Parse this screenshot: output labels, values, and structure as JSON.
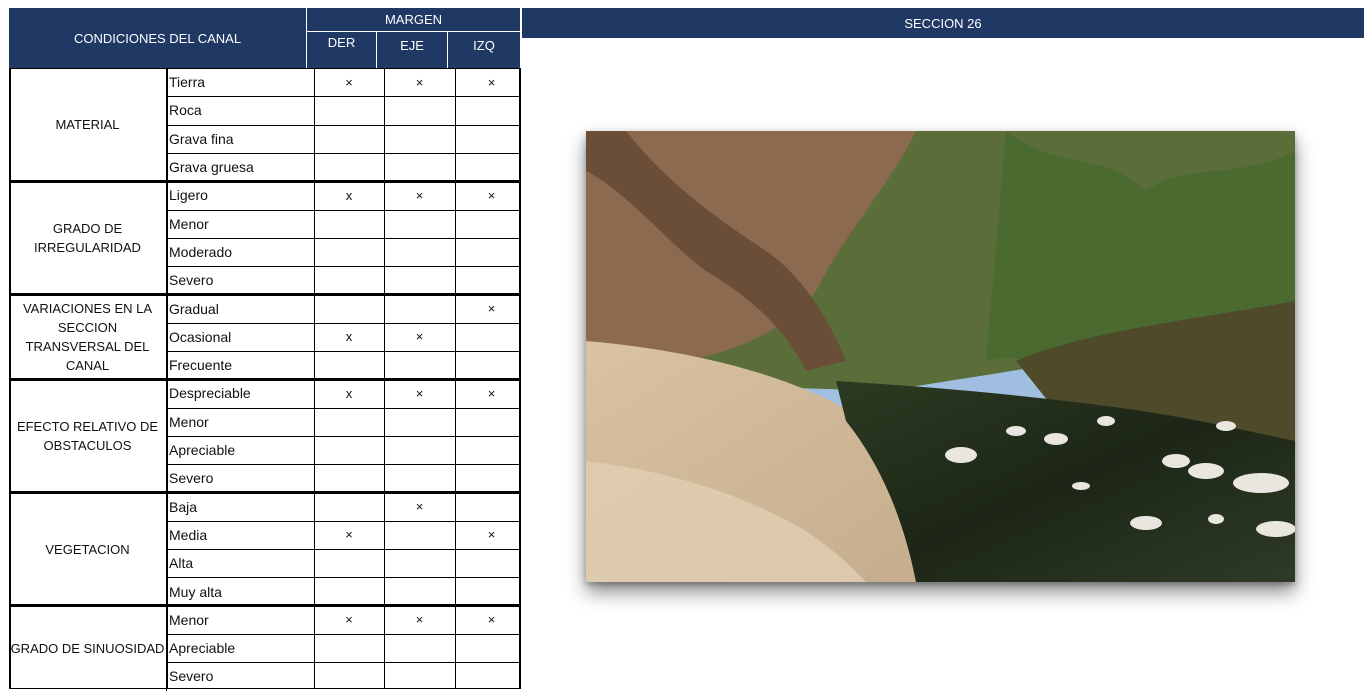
{
  "header": {
    "conditions_title": "CONDICIONES DEL CANAL",
    "margin_title": "MARGEN",
    "section_title": "SECCION 26",
    "columns": [
      "DER",
      "EJE",
      "IZQ"
    ]
  },
  "categories": [
    {
      "name": "MATERIAL",
      "rows": [
        {
          "option": "Tierra",
          "der": "×",
          "eje": "×",
          "izq": "×"
        },
        {
          "option": "Roca",
          "der": "",
          "eje": "",
          "izq": ""
        },
        {
          "option": "Grava fina",
          "der": "",
          "eje": "",
          "izq": ""
        },
        {
          "option": "Grava gruesa",
          "der": "",
          "eje": "",
          "izq": ""
        }
      ]
    },
    {
      "name": "GRADO DE IRREGULARIDAD",
      "rows": [
        {
          "option": "Ligero",
          "der": "x",
          "eje": "×",
          "izq": "×"
        },
        {
          "option": "Menor",
          "der": "",
          "eje": "",
          "izq": ""
        },
        {
          "option": "Moderado",
          "der": "",
          "eje": "",
          "izq": ""
        },
        {
          "option": "Severo",
          "der": "",
          "eje": "",
          "izq": ""
        }
      ]
    },
    {
      "name": "VARIACIONES EN LA SECCION TRANSVERSAL DEL CANAL",
      "rows": [
        {
          "option": "Gradual",
          "der": "",
          "eje": "",
          "izq": "×"
        },
        {
          "option": "Ocasional",
          "der": "x",
          "eje": "×",
          "izq": ""
        },
        {
          "option": "Frecuente",
          "der": "",
          "eje": "",
          "izq": ""
        }
      ]
    },
    {
      "name": "EFECTO RELATIVO DE OBSTACULOS",
      "rows": [
        {
          "option": "Despreciable",
          "der": "x",
          "eje": "×",
          "izq": "×"
        },
        {
          "option": "Menor",
          "der": "",
          "eje": "",
          "izq": ""
        },
        {
          "option": "Apreciable",
          "der": "",
          "eje": "",
          "izq": ""
        },
        {
          "option": "Severo",
          "der": "",
          "eje": "",
          "izq": ""
        }
      ]
    },
    {
      "name": "VEGETACION",
      "rows": [
        {
          "option": "Baja",
          "der": "",
          "eje": "×",
          "izq": ""
        },
        {
          "option": "Media",
          "der": "×",
          "eje": "",
          "izq": "×"
        },
        {
          "option": "Alta",
          "der": "",
          "eje": "",
          "izq": ""
        },
        {
          "option": "Muy alta",
          "der": "",
          "eje": "",
          "izq": ""
        }
      ]
    },
    {
      "name": "GRADO DE SINUOSIDAD",
      "rows": [
        {
          "option": "Menor",
          "der": "×",
          "eje": "×",
          "izq": "×"
        },
        {
          "option": "Apreciable",
          "der": "",
          "eje": "",
          "izq": ""
        },
        {
          "option": "Severo",
          "der": "",
          "eje": "",
          "izq": ""
        }
      ]
    }
  ],
  "photo": {
    "subject": "river-channel-photo"
  }
}
